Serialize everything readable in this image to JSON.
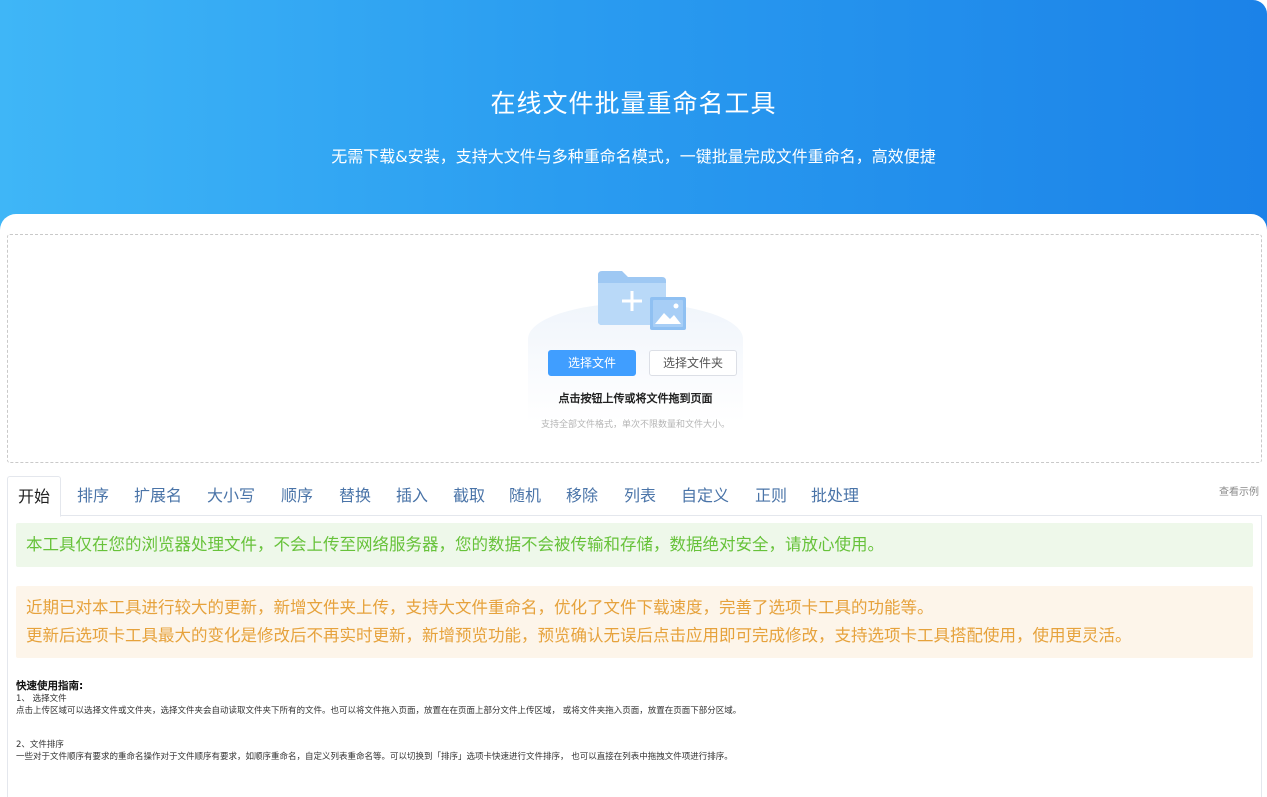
{
  "hero": {
    "title": "在线文件批量重命名工具",
    "subtitle": "无需下载&安装，支持大文件与多种重命名模式，一键批量完成文件重命名，高效便捷"
  },
  "upload": {
    "icon": "folder-plus-image-icon",
    "select_files_label": "选择文件",
    "select_folder_label": "选择文件夹",
    "hint": "点击按钮上传或将文件拖到页面",
    "subhint": "支持全部文件格式，单次不限数量和文件大小。"
  },
  "tabs": [
    {
      "label": "开始",
      "active": true
    },
    {
      "label": "排序"
    },
    {
      "label": "扩展名"
    },
    {
      "label": "大小写"
    },
    {
      "label": "顺序"
    },
    {
      "label": "替换"
    },
    {
      "label": "插入"
    },
    {
      "label": "截取"
    },
    {
      "label": "随机"
    },
    {
      "label": "移除"
    },
    {
      "label": "列表"
    },
    {
      "label": "自定义"
    },
    {
      "label": "正则"
    },
    {
      "label": "批处理"
    }
  ],
  "example_link": "查看示例",
  "alerts": {
    "security": "本工具仅在您的浏览器处理文件，不会上传至网络服务器，您的数据不会被传输和存储，数据绝对安全，请放心使用。",
    "update_line1": "近期已对本工具进行较大的更新，新增文件夹上传，支持大文件重命名，优化了文件下载速度，完善了选项卡工具的功能等。",
    "update_line2": "更新后选项卡工具最大的变化是修改后不再实时更新，新增预览功能，预览确认无误后点击应用即可完成修改，支持选项卡工具搭配使用，使用更灵活。"
  },
  "guide": {
    "title": "快速使用指南:",
    "step1_title": "1、 选择文件",
    "step1_text": "点击上传区域可以选择文件或文件夹，选择文件夹会自动读取文件夹下所有的文件。也可以将文件拖入页面，放置在在页面上部分文件上传区域， 或将文件夹拖入页面，放置在页面下部分区域。",
    "step2_title": "2、文件排序",
    "step2_text": "一些对于文件顺序有要求的重命名操作对于文件顺序有要求，如顺序重命名，自定义列表重命名等。可以切换到「排序」选项卡快速进行文件排序， 也可以直接在列表中拖拽文件项进行排序。"
  },
  "colors": {
    "primary": "#409eff",
    "success_text": "#67c23a",
    "success_bg": "#eef8ea",
    "warning_text": "#e6a23c",
    "warning_bg": "#fdf5ea"
  }
}
